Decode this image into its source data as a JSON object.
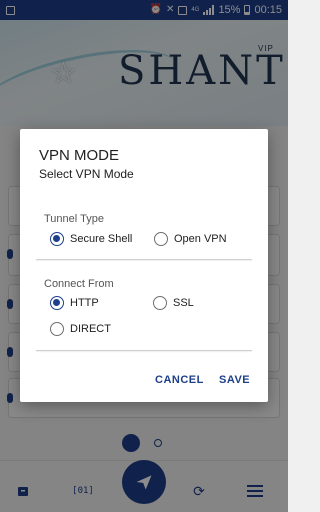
{
  "status_bar": {
    "network_label": "4G",
    "battery_pct": "15%",
    "time": "00:15"
  },
  "header": {
    "logo_text": "SHANTI",
    "logo_badge": "VIP"
  },
  "dialog": {
    "title": "VPN MODE",
    "subtitle": "Select VPN Mode",
    "tunnel_type": {
      "label": "Tunnel Type",
      "options": [
        {
          "label": "Secure Shell",
          "selected": true
        },
        {
          "label": "Open VPN",
          "selected": false
        }
      ]
    },
    "connect_from": {
      "label": "Connect From",
      "options": [
        {
          "label": "HTTP",
          "selected": true
        },
        {
          "label": "SSL",
          "selected": false
        },
        {
          "label": "DIRECT",
          "selected": false
        }
      ]
    },
    "cancel_label": "CANCEL",
    "save_label": "SAVE"
  },
  "colors": {
    "accent": "#1e3f8a",
    "status_bar": "#1e3f8a",
    "scrim": "rgba(0,0,0,0.45)"
  },
  "icons": {
    "status_left": "gallery-icon",
    "status_right": [
      "alarm-icon",
      "mute-icon",
      "data-icon",
      "signal-icon",
      "battery-icon"
    ],
    "bottom_nav": [
      "log-icon",
      "code-icon",
      "send-icon",
      "refresh-icon",
      "menu-icon"
    ]
  }
}
